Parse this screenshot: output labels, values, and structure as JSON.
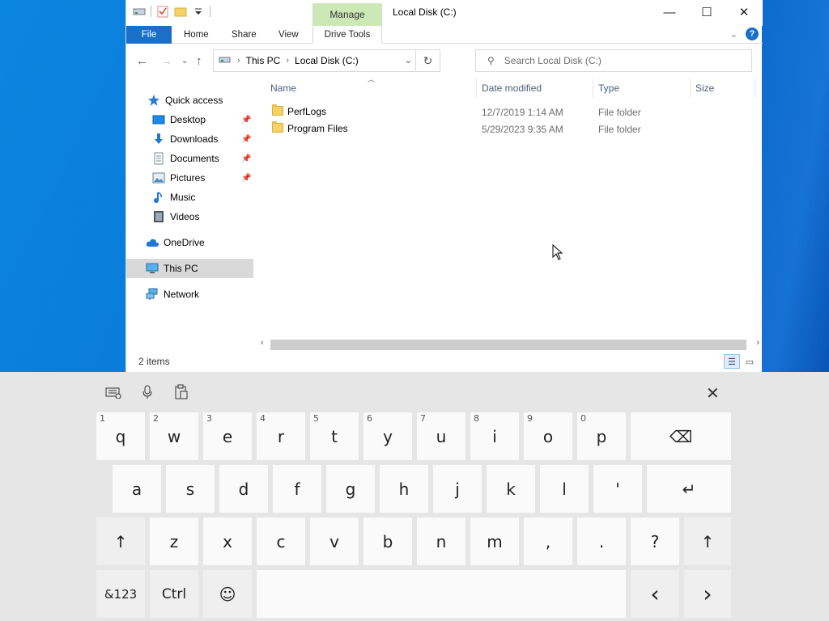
{
  "window": {
    "title": "Local Disk (C:)",
    "context_tab": "Manage",
    "buttons": {
      "minimize": "—",
      "maximize": "☐",
      "close": "✕"
    }
  },
  "ribbon": {
    "tabs": [
      "File",
      "Home",
      "Share",
      "View",
      "Drive Tools"
    ]
  },
  "address": {
    "crumbs": [
      "This PC",
      "Local Disk (C:)"
    ],
    "search_placeholder": "Search Local Disk (C:)"
  },
  "nav": {
    "items": [
      {
        "label": "Quick access",
        "icon": "star-icon"
      },
      {
        "label": "Desktop",
        "icon": "desktop-icon",
        "pinned": true
      },
      {
        "label": "Downloads",
        "icon": "download-icon",
        "pinned": true
      },
      {
        "label": "Documents",
        "icon": "documents-icon",
        "pinned": true
      },
      {
        "label": "Pictures",
        "icon": "pictures-icon",
        "pinned": true
      },
      {
        "label": "Music",
        "icon": "music-icon"
      },
      {
        "label": "Videos",
        "icon": "videos-icon"
      },
      {
        "label": "OneDrive",
        "icon": "cloud-icon"
      },
      {
        "label": "This PC",
        "icon": "computer-icon",
        "selected": true
      },
      {
        "label": "Network",
        "icon": "network-icon"
      }
    ]
  },
  "columns": [
    "Name",
    "Date modified",
    "Type",
    "Size"
  ],
  "files": [
    {
      "name": "PerfLogs",
      "date": "12/7/2019 1:14 AM",
      "type": "File folder"
    },
    {
      "name": "Program Files",
      "date": "5/29/2023 9:35 AM",
      "type": "File folder"
    }
  ],
  "status": {
    "items": "2 items"
  },
  "keyboard": {
    "row1": [
      {
        "k": "q",
        "n": "1"
      },
      {
        "k": "w",
        "n": "2"
      },
      {
        "k": "e",
        "n": "3"
      },
      {
        "k": "r",
        "n": "4"
      },
      {
        "k": "t",
        "n": "5"
      },
      {
        "k": "y",
        "n": "6"
      },
      {
        "k": "u",
        "n": "7"
      },
      {
        "k": "i",
        "n": "8"
      },
      {
        "k": "o",
        "n": "9"
      },
      {
        "k": "p",
        "n": "0"
      }
    ],
    "row2": [
      "a",
      "s",
      "d",
      "f",
      "g",
      "h",
      "j",
      "k",
      "l",
      "'"
    ],
    "row3": [
      "z",
      "x",
      "c",
      "v",
      "b",
      "n",
      "m",
      ",",
      ".",
      "?"
    ],
    "symbols_label": "&123",
    "ctrl_label": "Ctrl",
    "emoji": "☺",
    "backspace": "⌫",
    "enter": "↵",
    "shift": "↑",
    "left": "‹",
    "right": "›",
    "close": "✕"
  }
}
